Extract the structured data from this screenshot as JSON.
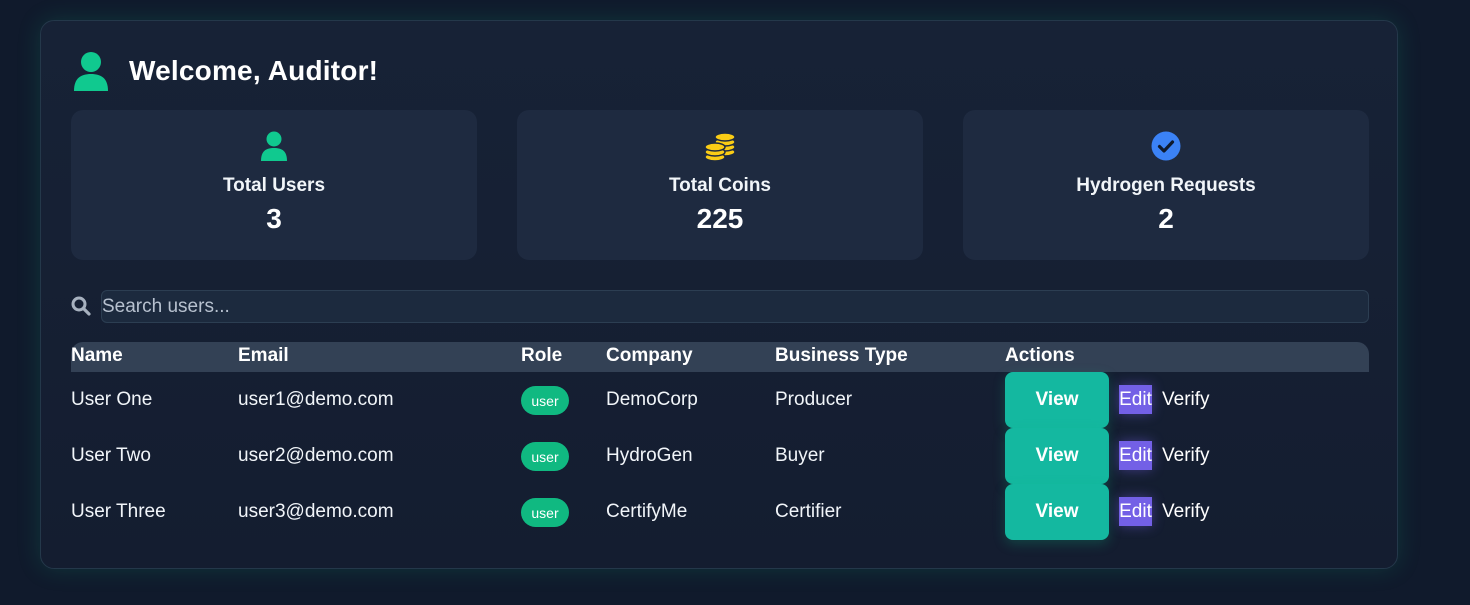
{
  "header": {
    "title": "Welcome, Auditor!",
    "icon": "user-icon"
  },
  "stats": [
    {
      "icon": "user-icon",
      "label": "Total Users",
      "value": "3"
    },
    {
      "icon": "coins-icon",
      "label": "Total Coins",
      "value": "225"
    },
    {
      "icon": "check-circle-icon",
      "label": "Hydrogen Requests",
      "value": "2"
    }
  ],
  "search": {
    "placeholder": "Search users...",
    "value": ""
  },
  "table": {
    "columns": [
      "Name",
      "Email",
      "Role",
      "Company",
      "Business Type",
      "Actions"
    ],
    "rows": [
      {
        "name": "User One",
        "email": "user1@demo.com",
        "role": "user",
        "company": "DemoCorp",
        "business_type": "Producer"
      },
      {
        "name": "User Two",
        "email": "user2@demo.com",
        "role": "user",
        "company": "HydroGen",
        "business_type": "Buyer"
      },
      {
        "name": "User Three",
        "email": "user3@demo.com",
        "role": "user",
        "company": "CertifyMe",
        "business_type": "Certifier"
      }
    ],
    "actions": {
      "view": "View",
      "edit": "Edit",
      "verify": "Verify"
    }
  },
  "colors": {
    "accent": "#10b981",
    "teal_button": "#14b8a0",
    "edit_button": "#7360e6",
    "coin": "#facc15",
    "check": "#3b82f6",
    "card": "#1e2a40",
    "background": "#101a2c"
  }
}
